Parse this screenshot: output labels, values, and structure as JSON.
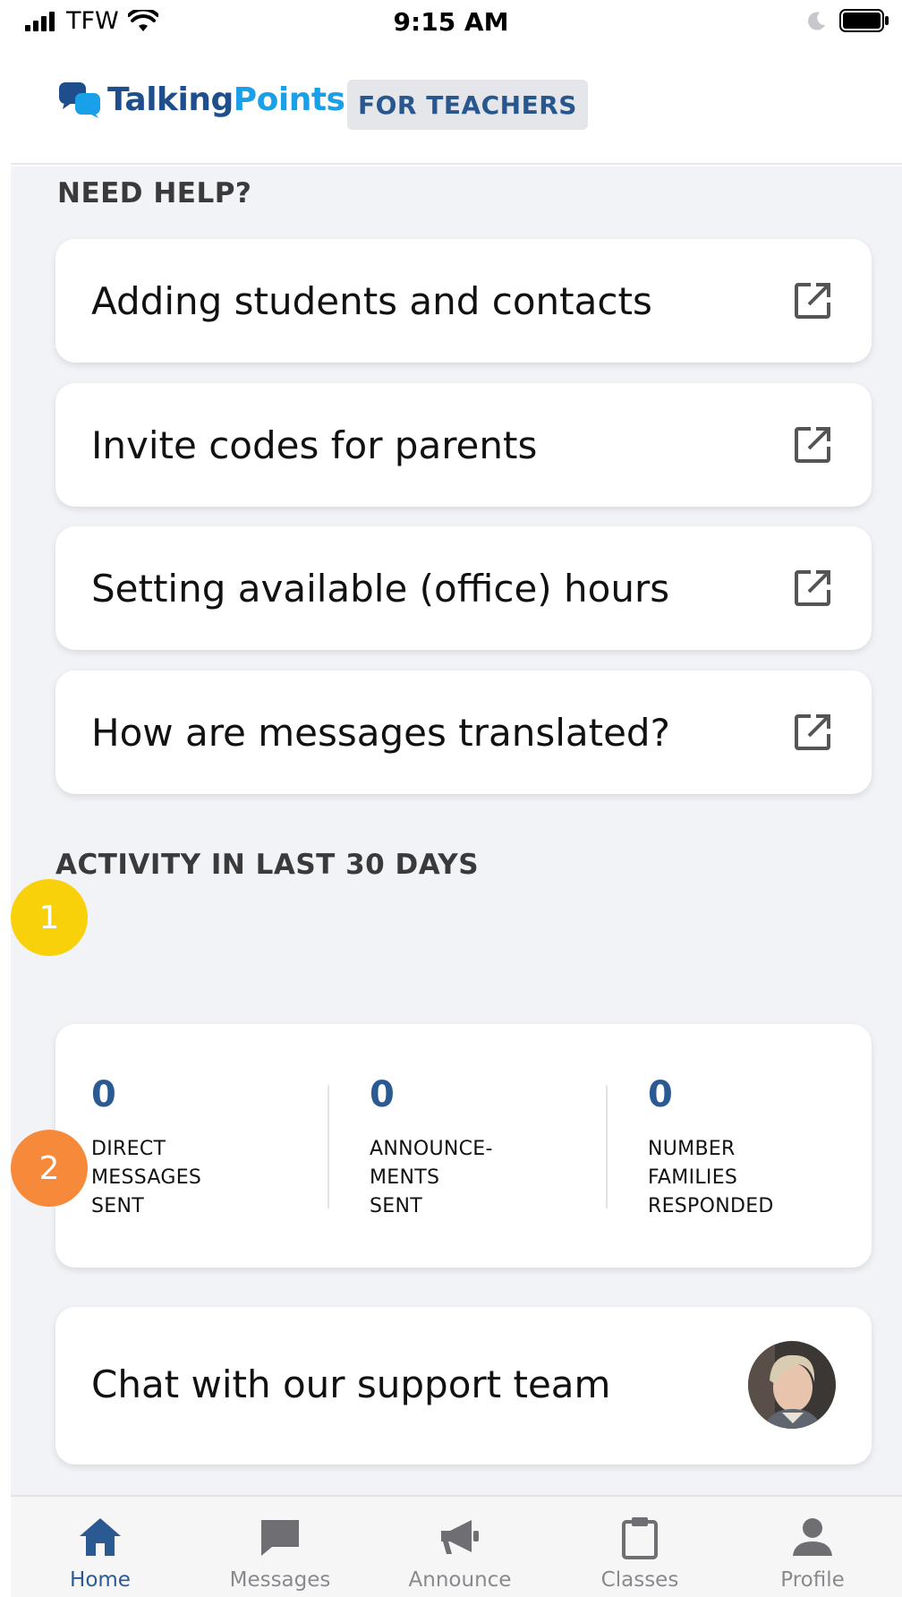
{
  "status_bar": {
    "carrier": "TFW",
    "time": "9:15 AM"
  },
  "header": {
    "logo_part1": "Talking",
    "logo_part2": "Points",
    "badge": "FOR TEACHERS"
  },
  "help": {
    "title": "NEED HELP?",
    "items": [
      {
        "label": "Adding students and contacts",
        "icon": "external-link-icon"
      },
      {
        "label": "Invite codes for parents",
        "icon": "external-link-icon"
      },
      {
        "label": "Setting available (office) hours",
        "icon": "external-link-icon"
      },
      {
        "label": "How are messages translated?",
        "icon": "external-link-icon"
      }
    ]
  },
  "activity": {
    "title": "ACTIVITY IN LAST 30 DAYS",
    "stats": [
      {
        "value": "0",
        "line1": "DIRECT",
        "line2": "MESSAGES",
        "line3": "SENT"
      },
      {
        "value": "0",
        "line1": "ANNOUNCE-",
        "line2": "MENTS",
        "line3": "SENT"
      },
      {
        "value": "0",
        "line1": "NUMBER",
        "line2": "FAMILIES",
        "line3": "RESPONDED"
      }
    ]
  },
  "chat": {
    "label": "Chat with our support team"
  },
  "markers": [
    {
      "label": "1",
      "color": "#f9d10a"
    },
    {
      "label": "2",
      "color": "#f7893b"
    }
  ],
  "tabs": [
    {
      "label": "Home",
      "icon": "home-icon",
      "active": true
    },
    {
      "label": "Messages",
      "icon": "chat-bubble-icon",
      "active": false
    },
    {
      "label": "Announce",
      "icon": "megaphone-icon",
      "active": false
    },
    {
      "label": "Classes",
      "icon": "clipboard-icon",
      "active": false
    },
    {
      "label": "Profile",
      "icon": "person-icon",
      "active": false
    }
  ],
  "colors": {
    "brand_dark": "#1f4e8c",
    "brand_light": "#1aa0e8",
    "accent": "#2b5a93",
    "background": "#f1f3f7"
  }
}
